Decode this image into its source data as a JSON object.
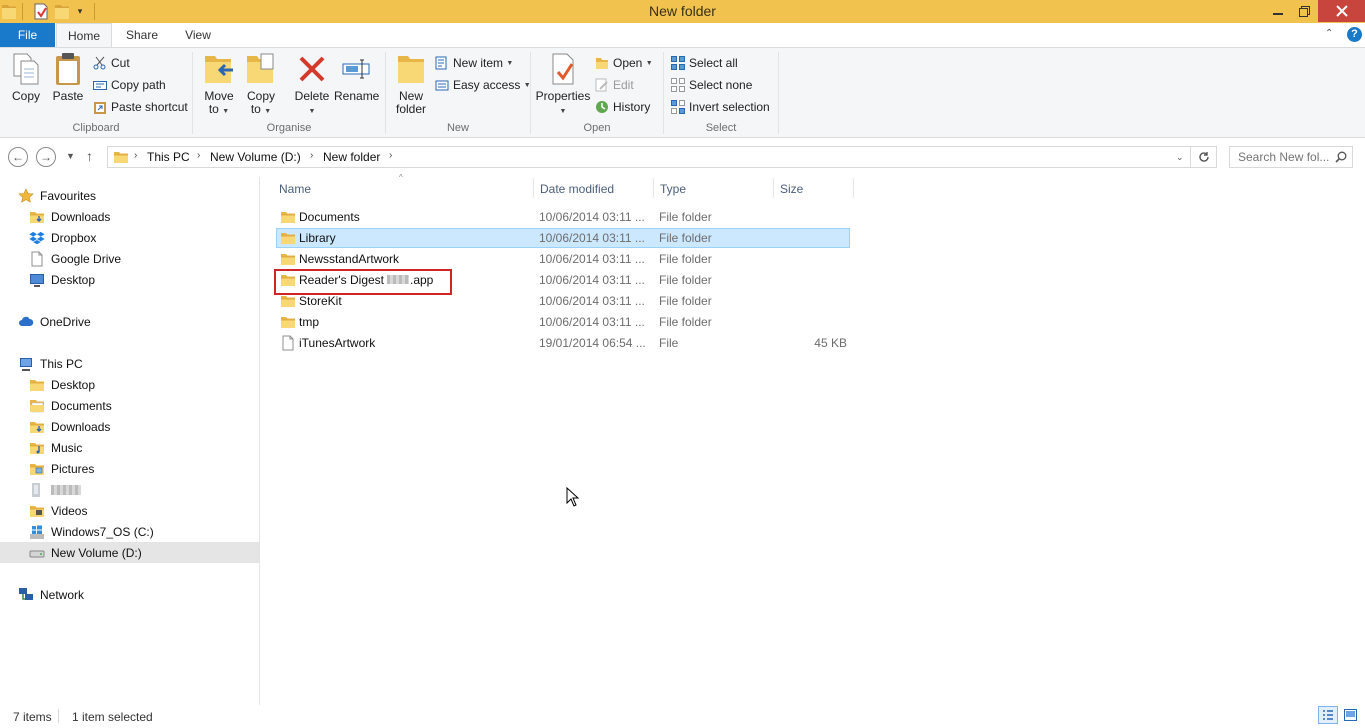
{
  "window": {
    "title": "New folder"
  },
  "tabs": {
    "file": "File",
    "home": "Home",
    "share": "Share",
    "view": "View"
  },
  "ribbon": {
    "clipboard": {
      "copy": "Copy",
      "paste": "Paste",
      "cut": "Cut",
      "copy_path": "Copy path",
      "paste_shortcut": "Paste shortcut",
      "label": "Clipboard"
    },
    "organise": {
      "move_to": "Move",
      "move_to_2": "to",
      "copy_to": "Copy",
      "copy_to_2": "to",
      "delete": "Delete",
      "rename": "Rename",
      "label": "Organise"
    },
    "new": {
      "new_folder": "New",
      "new_folder_2": "folder",
      "new_item": "New item",
      "easy_access": "Easy access",
      "label": "New"
    },
    "open": {
      "properties": "Properties",
      "open": "Open",
      "edit": "Edit",
      "history": "History",
      "label": "Open"
    },
    "select": {
      "select_all": "Select all",
      "select_none": "Select none",
      "invert_selection": "Invert selection",
      "label": "Select"
    }
  },
  "address": {
    "crumbs": [
      "This PC",
      "New Volume (D:)",
      "New folder"
    ],
    "search_placeholder": "Search New fol..."
  },
  "nav": {
    "favourites": "Favourites",
    "downloads": "Downloads",
    "dropbox": "Dropbox",
    "google_drive": "Google Drive",
    "desktop": "Desktop",
    "onedrive": "OneDrive",
    "this_pc": "This PC",
    "pc_desktop": "Desktop",
    "pc_documents": "Documents",
    "pc_downloads": "Downloads",
    "pc_music": "Music",
    "pc_pictures": "Pictures",
    "pc_videos": "Videos",
    "drive_c": "Windows7_OS (C:)",
    "drive_d": "New Volume (D:)",
    "network": "Network"
  },
  "columns": {
    "name": "Name",
    "date": "Date modified",
    "type": "Type",
    "size": "Size"
  },
  "files": [
    {
      "name": "Documents",
      "date": "10/06/2014 03:11 ...",
      "type": "File folder",
      "size": ""
    },
    {
      "name": "Library",
      "date": "10/06/2014 03:11 ...",
      "type": "File folder",
      "size": ""
    },
    {
      "name": "NewsstandArtwork",
      "date": "10/06/2014 03:11 ...",
      "type": "File folder",
      "size": ""
    },
    {
      "name": "Reader's Digest",
      "name_suffix": ".app",
      "date": "10/06/2014 03:11 ...",
      "type": "File folder",
      "size": ""
    },
    {
      "name": "StoreKit",
      "date": "10/06/2014 03:11 ...",
      "type": "File folder",
      "size": ""
    },
    {
      "name": "tmp",
      "date": "10/06/2014 03:11 ...",
      "type": "File folder",
      "size": ""
    },
    {
      "name": "iTunesArtwork",
      "date": "19/01/2014 06:54 ...",
      "type": "File",
      "size": "45 KB"
    }
  ],
  "status": {
    "items": "7 items",
    "selected": "1 item selected"
  },
  "colors": {
    "titlebar": "#f1c24e",
    "file_tab": "#1979ca",
    "selection": "#cce8ff",
    "highlight_box": "#d2232a"
  }
}
